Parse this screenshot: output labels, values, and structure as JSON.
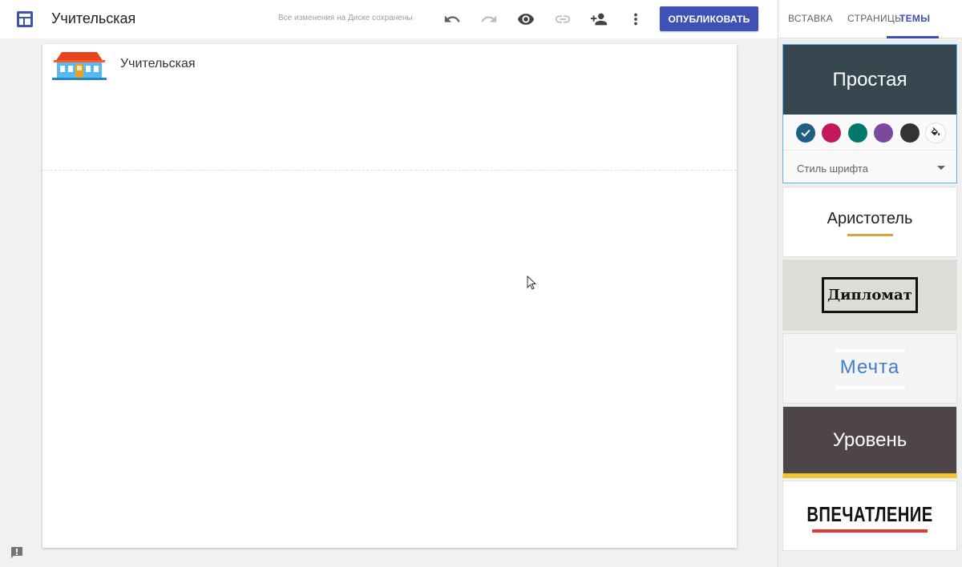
{
  "header": {
    "title": "Учительская",
    "save_status": "Все изменения на Диске сохранены",
    "publish_label": "ОПУБЛИКОВАТЬ",
    "icons": [
      "layout-icon",
      "undo-icon",
      "redo-icon",
      "preview-icon",
      "link-icon",
      "add-person-icon",
      "more-vert-icon"
    ]
  },
  "canvas": {
    "site_title": "Учительская"
  },
  "panel": {
    "tabs": [
      {
        "label": "ВСТАВКА"
      },
      {
        "label": "СТРАНИЦЫ"
      },
      {
        "label": "ТЕМЫ"
      }
    ],
    "active_tab": "ТЕМЫ",
    "themes": [
      {
        "name": "Простая",
        "selected": true,
        "font_style_label": "Стиль шрифта",
        "swatches": [
          "#1f5f86",
          "#c2185b",
          "#00796b",
          "#7b4a9c",
          "#333333"
        ]
      },
      {
        "name": "Аристотель"
      },
      {
        "name": "Дипломат"
      },
      {
        "name": "Мечта"
      },
      {
        "name": "Уровень"
      },
      {
        "name": "ВПЕЧАТЛЕНИЕ"
      }
    ]
  },
  "colors": {
    "accent": "#3f51b5",
    "simple_banner": "#37474f",
    "level_banner": "#4e4548",
    "level_stripe": "#f3c532",
    "impression_underline": "#e53935",
    "aristotle_underline": "#e0a040",
    "dream_text": "#3f7fcf"
  }
}
